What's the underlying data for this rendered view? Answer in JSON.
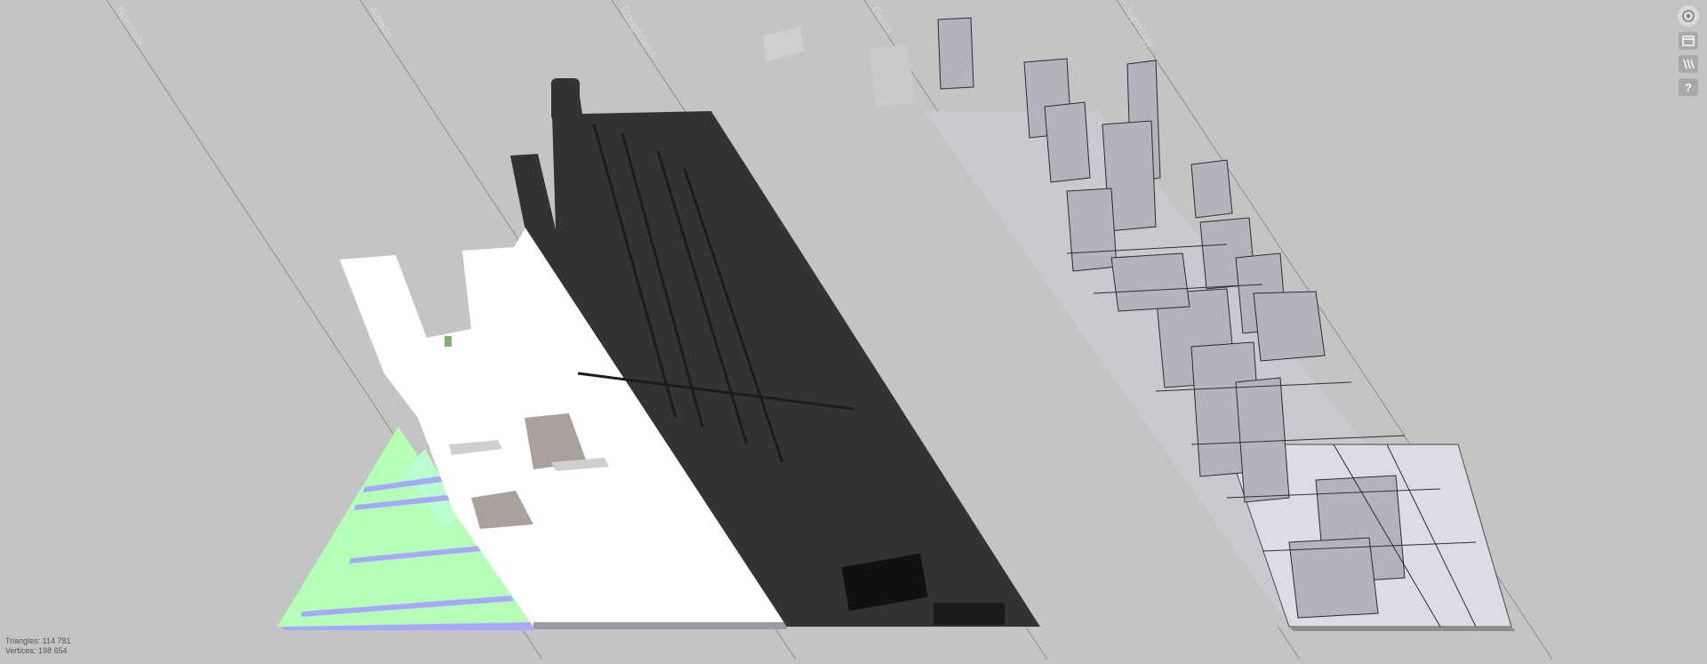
{
  "passes": [
    "Normals",
    "Albedo",
    "Roughness",
    "Gloss",
    "Topology"
  ],
  "toolbar": {
    "items": [
      {
        "name": "camera-orbit-icon"
      },
      {
        "name": "window-icon"
      },
      {
        "name": "stripes-view-icon"
      },
      {
        "name": "help-icon",
        "glyph": "?"
      }
    ]
  },
  "stats": {
    "triangles": "Triangles: 114 781",
    "vertices": "Vertices: 198 654"
  },
  "colors": {
    "background": "#c4c4c4",
    "normals": "#b6ffb6",
    "albedo": "#ffffff",
    "roughness": "#333333",
    "gloss": "#c4c4c4",
    "topology_building": "#b3b3bd"
  }
}
